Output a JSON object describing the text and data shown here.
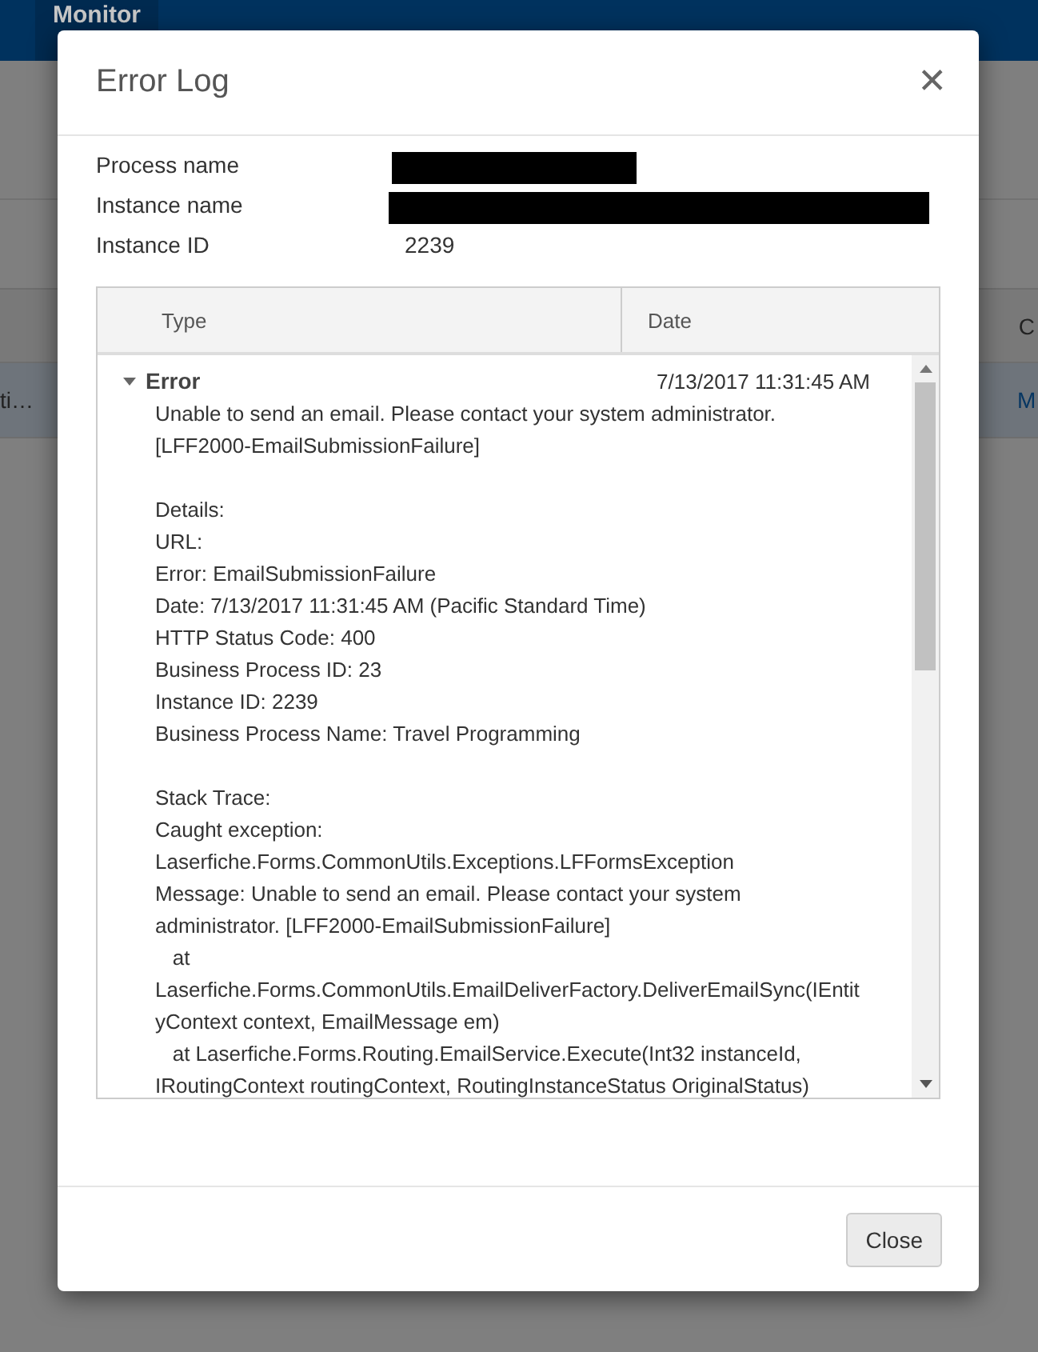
{
  "background": {
    "nav": [
      {
        "label": "Monitor",
        "selected": true
      }
    ],
    "table": {
      "header_right": "C",
      "row_left": "ti…",
      "row_right": "M"
    }
  },
  "dialog": {
    "title": "Error Log",
    "close_icon": "✕",
    "fields": [
      {
        "label": "Process name"
      },
      {
        "label": "Instance name"
      },
      {
        "label": "Instance ID",
        "value": "2239"
      }
    ],
    "log": {
      "columns": [
        "Type",
        "Date"
      ],
      "entries": [
        {
          "type": "Error",
          "date": "7/13/2017 11:31:45 AM",
          "expanded": true,
          "paragraphs": [
            [
              "Unable to send an email. Please contact your system administrator.",
              "[LFF2000-EmailSubmissionFailure]"
            ],
            [
              "Details:",
              "URL:",
              "Error: EmailSubmissionFailure",
              "Date: 7/13/2017 11:31:45 AM (Pacific Standard Time)",
              "HTTP Status Code: 400",
              "Business Process ID: 23",
              "Instance ID: 2239",
              "Business Process Name: Travel Programming"
            ],
            [
              "Stack Trace:",
              "Caught exception:",
              "Laserfiche.Forms.CommonUtils.Exceptions.LFFormsException",
              "Message: Unable to send an email. Please contact your system",
              "administrator. [LFF2000-EmailSubmissionFailure]",
              "   at",
              "Laserfiche.Forms.CommonUtils.EmailDeliverFactory.DeliverEmailSync(IEntit",
              "yContext context, EmailMessage em)",
              "   at Laserfiche.Forms.Routing.EmailService.Execute(Int32 instanceId,",
              "IRoutingContext routingContext, RoutingInstanceStatus OriginalStatus)"
            ]
          ]
        }
      ]
    },
    "buttons": [
      "Close"
    ]
  }
}
